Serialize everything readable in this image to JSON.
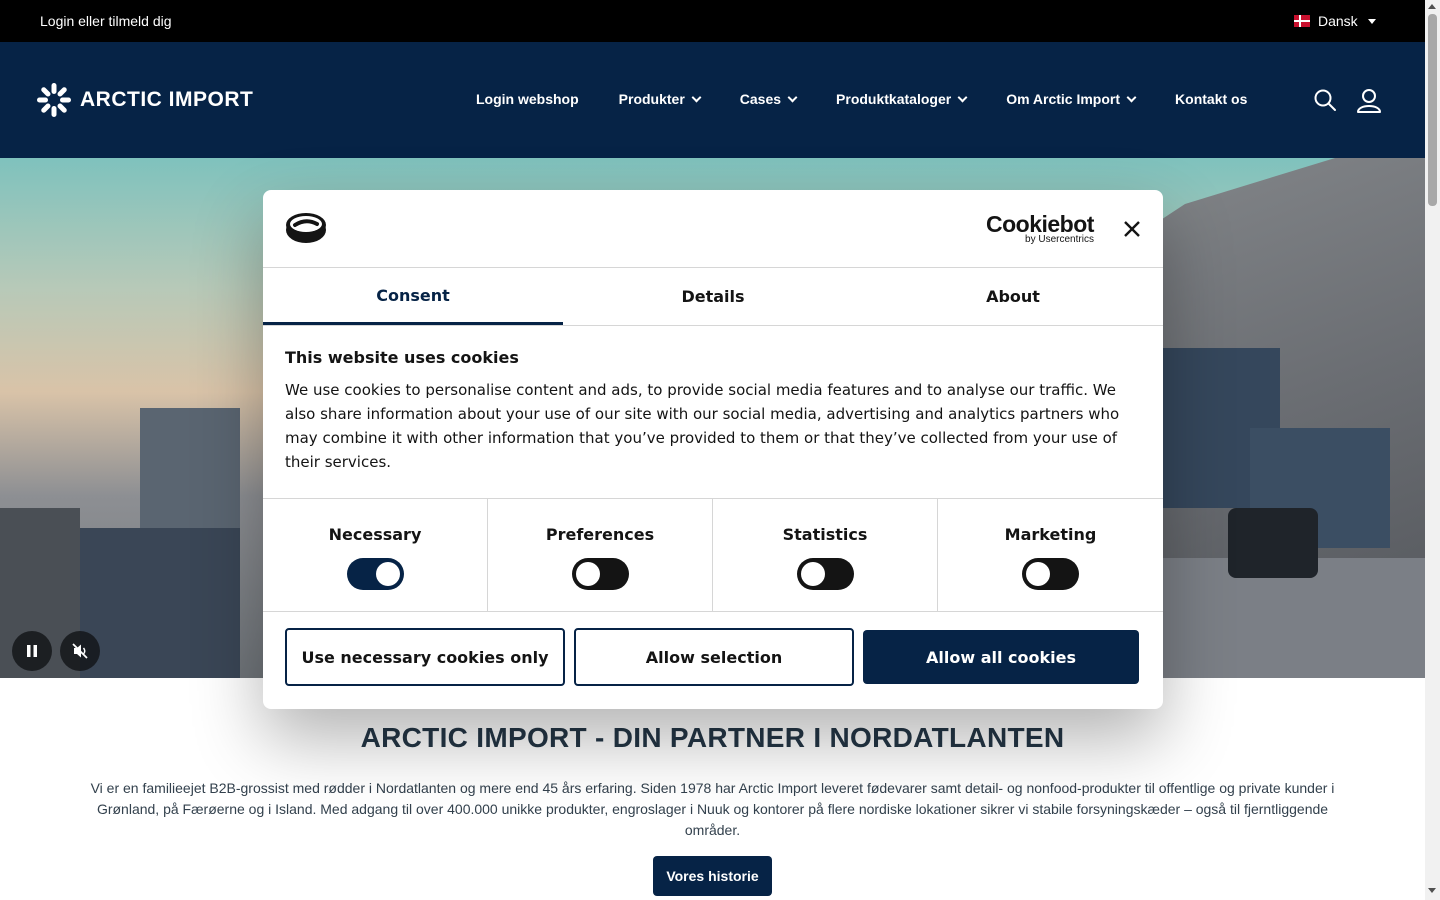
{
  "topbar": {
    "login_label": "Login eller tilmeld dig",
    "language": "Dansk"
  },
  "header": {
    "brand": "ARCTIC IMPORT",
    "nav": [
      {
        "label": "Login webshop",
        "dropdown": false
      },
      {
        "label": "Produkter",
        "dropdown": true
      },
      {
        "label": "Cases",
        "dropdown": true
      },
      {
        "label": "Produktkataloger",
        "dropdown": true
      },
      {
        "label": "Om Arctic Import",
        "dropdown": true
      },
      {
        "label": "Kontakt os",
        "dropdown": false
      }
    ],
    "icons": [
      "search-icon",
      "user-icon"
    ]
  },
  "hero": {
    "controls": [
      "pause-icon",
      "mute-icon"
    ]
  },
  "intro": {
    "title": "ARCTIC IMPORT - DIN PARTNER I NORDATLANTEN",
    "text": "Vi er en familieejet B2B-grossist med rødder i Nordatlanten og mere end 45 års erfaring. Siden 1978 har Arctic Import leveret fødevarer samt detail- og nonfood-produkter til offentlige og private kunder i Grønland, på Færøerne og i Island. Med adgang til over 400.000 unikke produkter, engroslager i Nuuk og kontorer på flere nordiske lokationer sikrer vi stabile forsyningskæder – også til fjerntliggende områder.",
    "button": "Vores historie"
  },
  "cookie_dialog": {
    "brand_name": "Cookiebot",
    "brand_by": "by Usercentrics",
    "tabs": [
      {
        "label": "Consent",
        "active": true
      },
      {
        "label": "Details",
        "active": false
      },
      {
        "label": "About",
        "active": false
      }
    ],
    "heading": "This website uses cookies",
    "body": "We use cookies to personalise content and ads, to provide social media features and to analyse our traffic. We also share information about your use of our site with our social media, advertising and analytics partners who may combine it with other information that you’ve provided to them or that they’ve collected from your use of their services.",
    "toggles": [
      {
        "label": "Necessary",
        "on": true
      },
      {
        "label": "Preferences",
        "on": false
      },
      {
        "label": "Statistics",
        "on": false
      },
      {
        "label": "Marketing",
        "on": false
      }
    ],
    "buttons": {
      "necessary_only": "Use necessary cookies only",
      "allow_selection": "Allow selection",
      "allow_all": "Allow all cookies"
    }
  },
  "colors": {
    "navy": "#062346",
    "black": "#000000",
    "text_dark": "#243646"
  }
}
